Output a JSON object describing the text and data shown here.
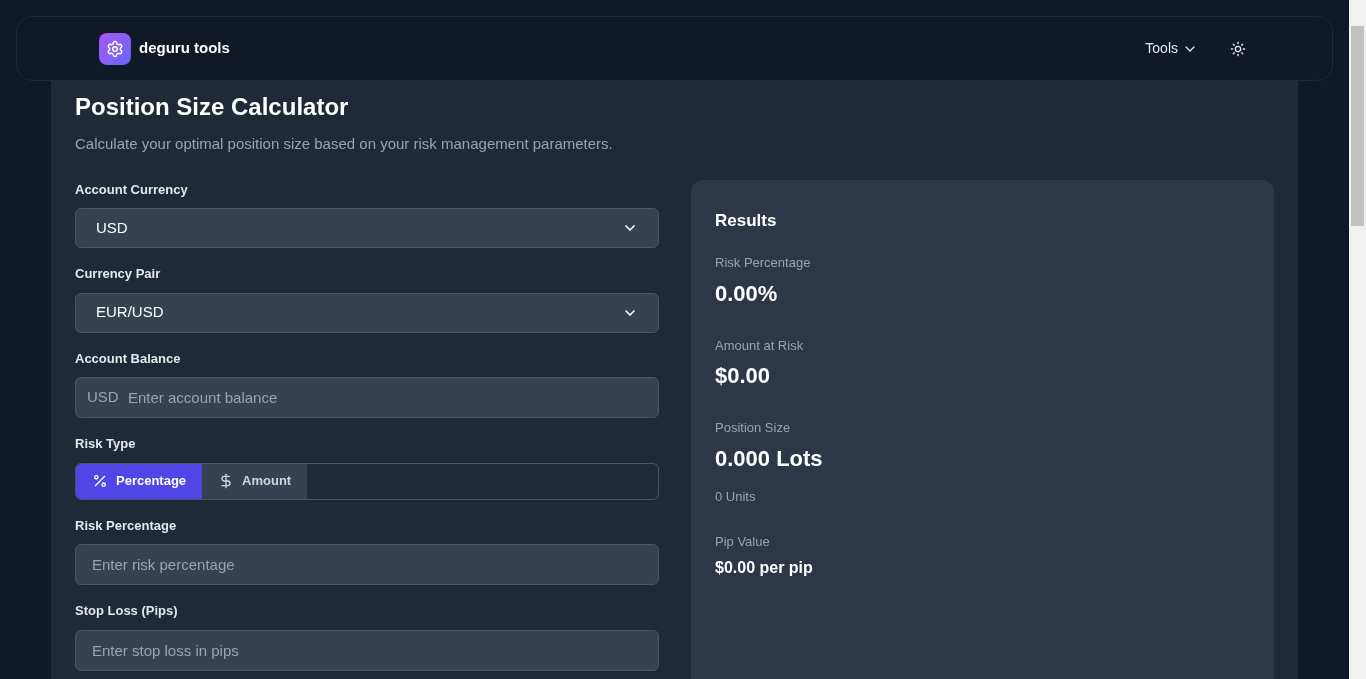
{
  "header": {
    "brand": "deguru tools",
    "nav": [
      {
        "label": "Tools",
        "kind": "dropdown"
      }
    ]
  },
  "page": {
    "title": "Position Size Calculator",
    "subtitle": "Calculate your optimal position size based on your risk management parameters."
  },
  "form": [
    {
      "kind": "select",
      "label": "Account Currency",
      "value": "USD"
    },
    {
      "kind": "select",
      "label": "Currency Pair",
      "value": "EUR/USD"
    },
    {
      "kind": "input",
      "label": "Account Balance",
      "prefix": "USD",
      "placeholder": "Enter account balance"
    },
    {
      "kind": "toggle",
      "label": "Risk Type",
      "options": [
        {
          "label": "Percentage",
          "selected": true
        },
        {
          "label": "Amount",
          "selected": false
        }
      ]
    },
    {
      "kind": "input",
      "label": "Risk Percentage",
      "placeholder": "Enter risk percentage"
    },
    {
      "kind": "input",
      "label": "Stop Loss (Pips)",
      "placeholder": "Enter stop loss in pips"
    }
  ],
  "results": {
    "title": "Results",
    "items": [
      {
        "label": "Risk Percentage",
        "value": "0.00%",
        "kind": "primary"
      },
      {
        "label": "Amount at Risk",
        "value": "$0.00",
        "kind": "primary"
      },
      {
        "label": "Position Size",
        "value": "0.000 Lots",
        "note": "0 Units",
        "kind": "primary"
      },
      {
        "label": "Pip Value",
        "value": "$0.00 per pip",
        "kind": "secondary"
      }
    ]
  }
}
